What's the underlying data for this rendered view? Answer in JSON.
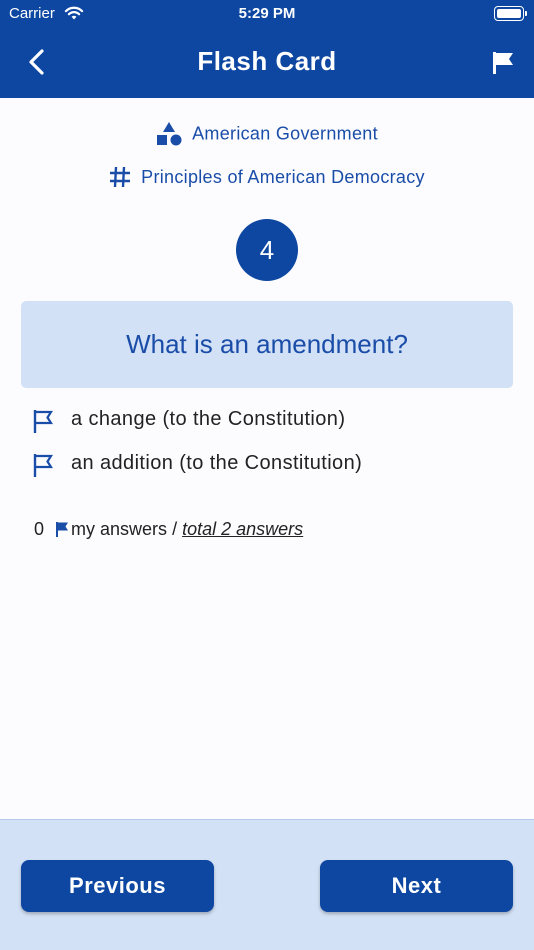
{
  "status_bar": {
    "carrier": "Carrier",
    "time": "5:29 PM"
  },
  "nav": {
    "title": "Flash Card",
    "back_icon": "chevron-left-icon",
    "flag_icon": "flag-icon"
  },
  "category": {
    "icon": "shapes-icon",
    "label": "American Government"
  },
  "subcategory": {
    "icon": "hashtag-icon",
    "label": "Principles of American Democracy"
  },
  "question": {
    "number": "4",
    "text": "What is an amendment?"
  },
  "answers": [
    {
      "icon": "flag-outline-icon",
      "text": "a change (to the Constitution)"
    },
    {
      "icon": "flag-outline-icon",
      "text": "an addition (to the Constitution)"
    }
  ],
  "summary": {
    "count": "0",
    "my_answers": "my answers",
    "separator": "/",
    "total": "total 2 answers"
  },
  "footer": {
    "previous_label": "Previous",
    "next_label": "Next"
  },
  "colors": {
    "primary": "#0d47a1",
    "accent_text": "#1a4da8",
    "panel": "#d3e1f6"
  }
}
